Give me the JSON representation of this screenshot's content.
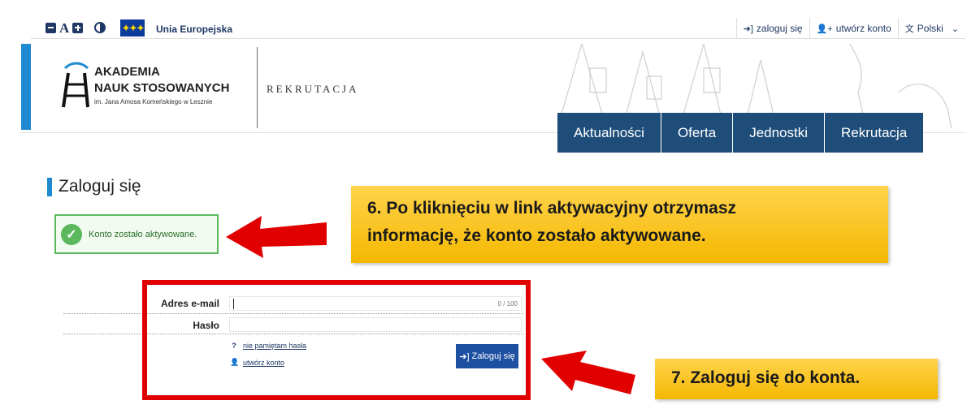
{
  "topbar": {
    "a11y_big_a": "A",
    "eu_label": "Unia Europejska",
    "login_link": "zaloguj się",
    "create_account_link": "utwórz konto",
    "language": "Polski"
  },
  "header": {
    "logo_line1": "AKADEMIA",
    "logo_line2": "NAUK STOSOWANYCH",
    "logo_line3": "im. Jana Amosa Komeńskiego w Lesznie",
    "section_name": "REKRUTACJA",
    "nav": [
      "Aktualności",
      "Oferta",
      "Jednostki",
      "Rekrutacja"
    ]
  },
  "page": {
    "title": "Zaloguj się",
    "success_message": "Konto zostało aktywowane."
  },
  "form": {
    "email_label": "Adres e-mail",
    "email_value": "",
    "email_counter": "0 / 100",
    "password_label": "Hasło",
    "forgot_password": "nie pamiętam hasła",
    "create_account": "utwórz konto",
    "login_button": "Zaloguj się"
  },
  "annotations": {
    "step6_line1": "6. Po kliknięciu w link aktywacyjny otrzymasz",
    "step6_line2": "informację, że konto zostało aktywowane.",
    "step7": "7. Zaloguj się do konta."
  },
  "colors": {
    "navy": "#1e4d7a",
    "accent_blue": "#1f8ad1",
    "callout_yellow": "#f5b800",
    "annotation_red": "#e00000",
    "success_green": "#5cb85c"
  }
}
